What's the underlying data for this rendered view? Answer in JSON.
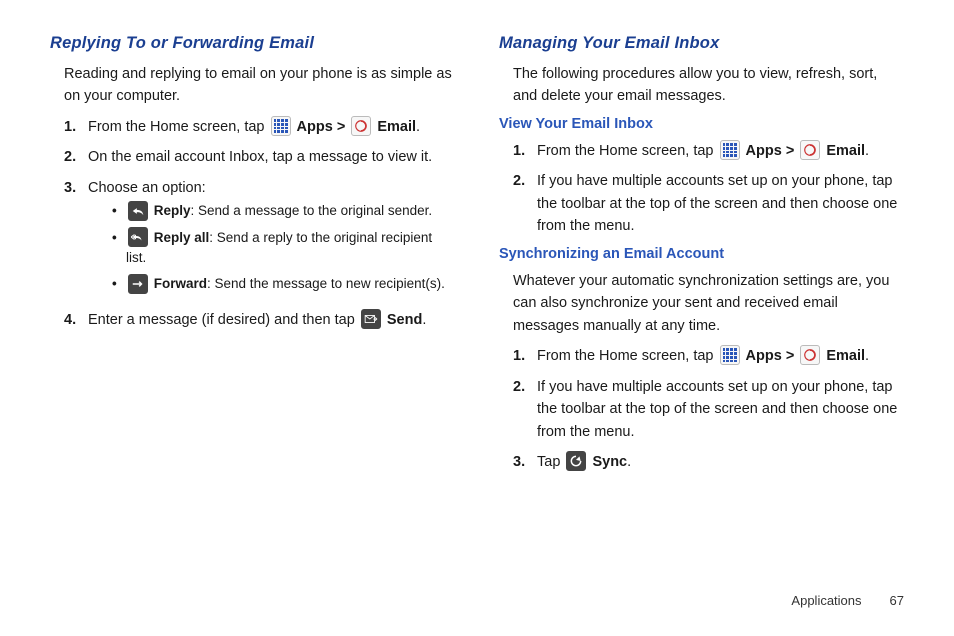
{
  "left": {
    "heading": "Replying To or Forwarding Email",
    "intro": "Reading and replying to email on your phone is as simple as on your computer.",
    "step1_pre": "From the Home screen, tap ",
    "apps_label": "Apps >",
    "email_label": "Email",
    "step2": "On the email account Inbox, tap a message to view it.",
    "step3": "Choose an option:",
    "reply_label": "Reply",
    "reply_desc": ": Send a message to the original sender.",
    "replyall_label": "Reply all",
    "replyall_desc": ": Send a reply to the original recipient list.",
    "forward_label": "Forward",
    "forward_desc": ": Send the message to new recipient(s).",
    "step4_pre": "Enter a message (if desired) and then tap ",
    "send_label": "Send"
  },
  "right": {
    "heading": "Managing Your Email Inbox",
    "intro": "The following procedures allow you to view, refresh, sort, and delete your email messages.",
    "view_heading": "View Your Email Inbox",
    "view_step1_pre": "From the Home screen, tap ",
    "view_step2": "If you have multiple accounts set up on your phone, tap the toolbar at the top of the screen and then choose one from the menu.",
    "sync_heading": "Synchronizing an Email Account",
    "sync_intro": "Whatever your automatic synchronization settings are, you can also synchronize your sent and received email messages manually at any time.",
    "sync_step1_pre": "From the Home screen, tap ",
    "sync_step2": "If you have multiple accounts set up on your phone, tap the toolbar at the top of the screen and then choose one from the menu.",
    "sync_step3_pre": "Tap ",
    "sync_label": "Sync"
  },
  "footer": {
    "section": "Applications",
    "page": "67"
  }
}
